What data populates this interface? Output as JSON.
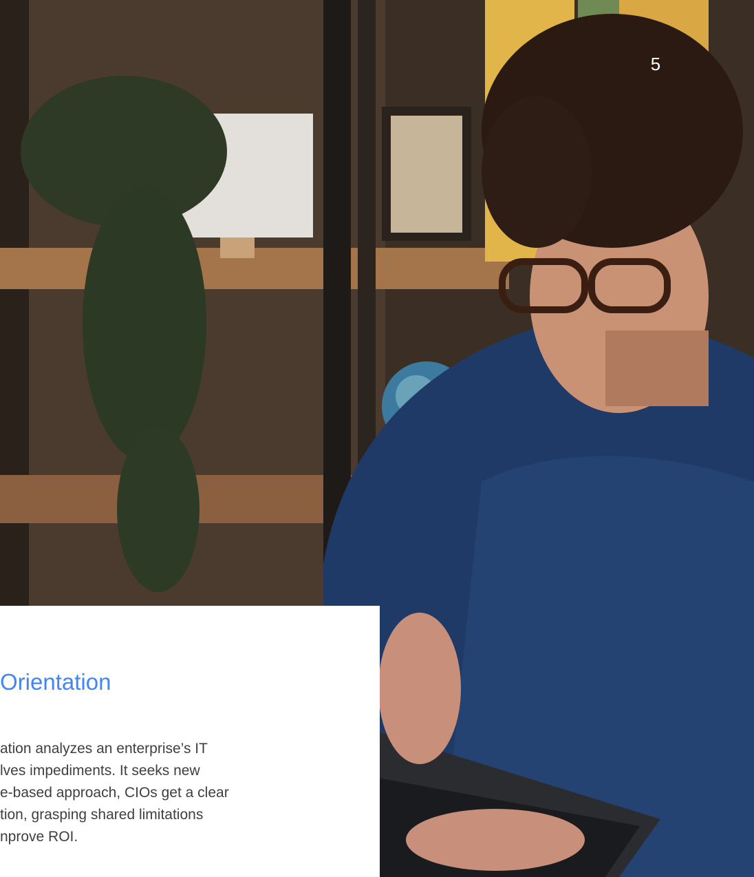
{
  "page": {
    "number": "5"
  },
  "section": {
    "heading": "Orientation",
    "body_lines": [
      "ation analyzes an enterprise’s IT",
      "lves impediments. It seeks new",
      "e-based approach, CIOs get a clear",
      "tion, grasping shared limitations",
      "nprove ROI."
    ]
  },
  "colors": {
    "heading_accent": "#4285f4",
    "body_text": "#3c4043",
    "page_number": "#ffffff"
  }
}
